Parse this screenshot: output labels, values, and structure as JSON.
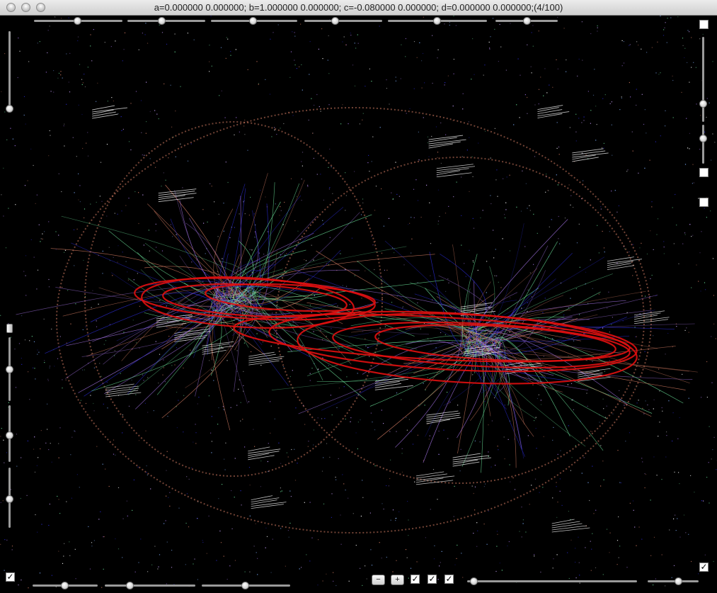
{
  "window": {
    "title": "a=0.000000 0.000000; b=1.000000 0.000000; c=-0.080000 0.000000; d=0.000000 0.000000;(4/100)"
  },
  "bottom_toolbar": {
    "minus_label": "−",
    "plus_label": "+",
    "check_mark": "✓"
  },
  "colors": {
    "background": "#000000",
    "orbit_red": "#e01010",
    "green": "#6be39a",
    "blue": "#2a2ad0",
    "salmon": "#d07a60",
    "violet": "#a070e0",
    "white": "#ffffff"
  }
}
